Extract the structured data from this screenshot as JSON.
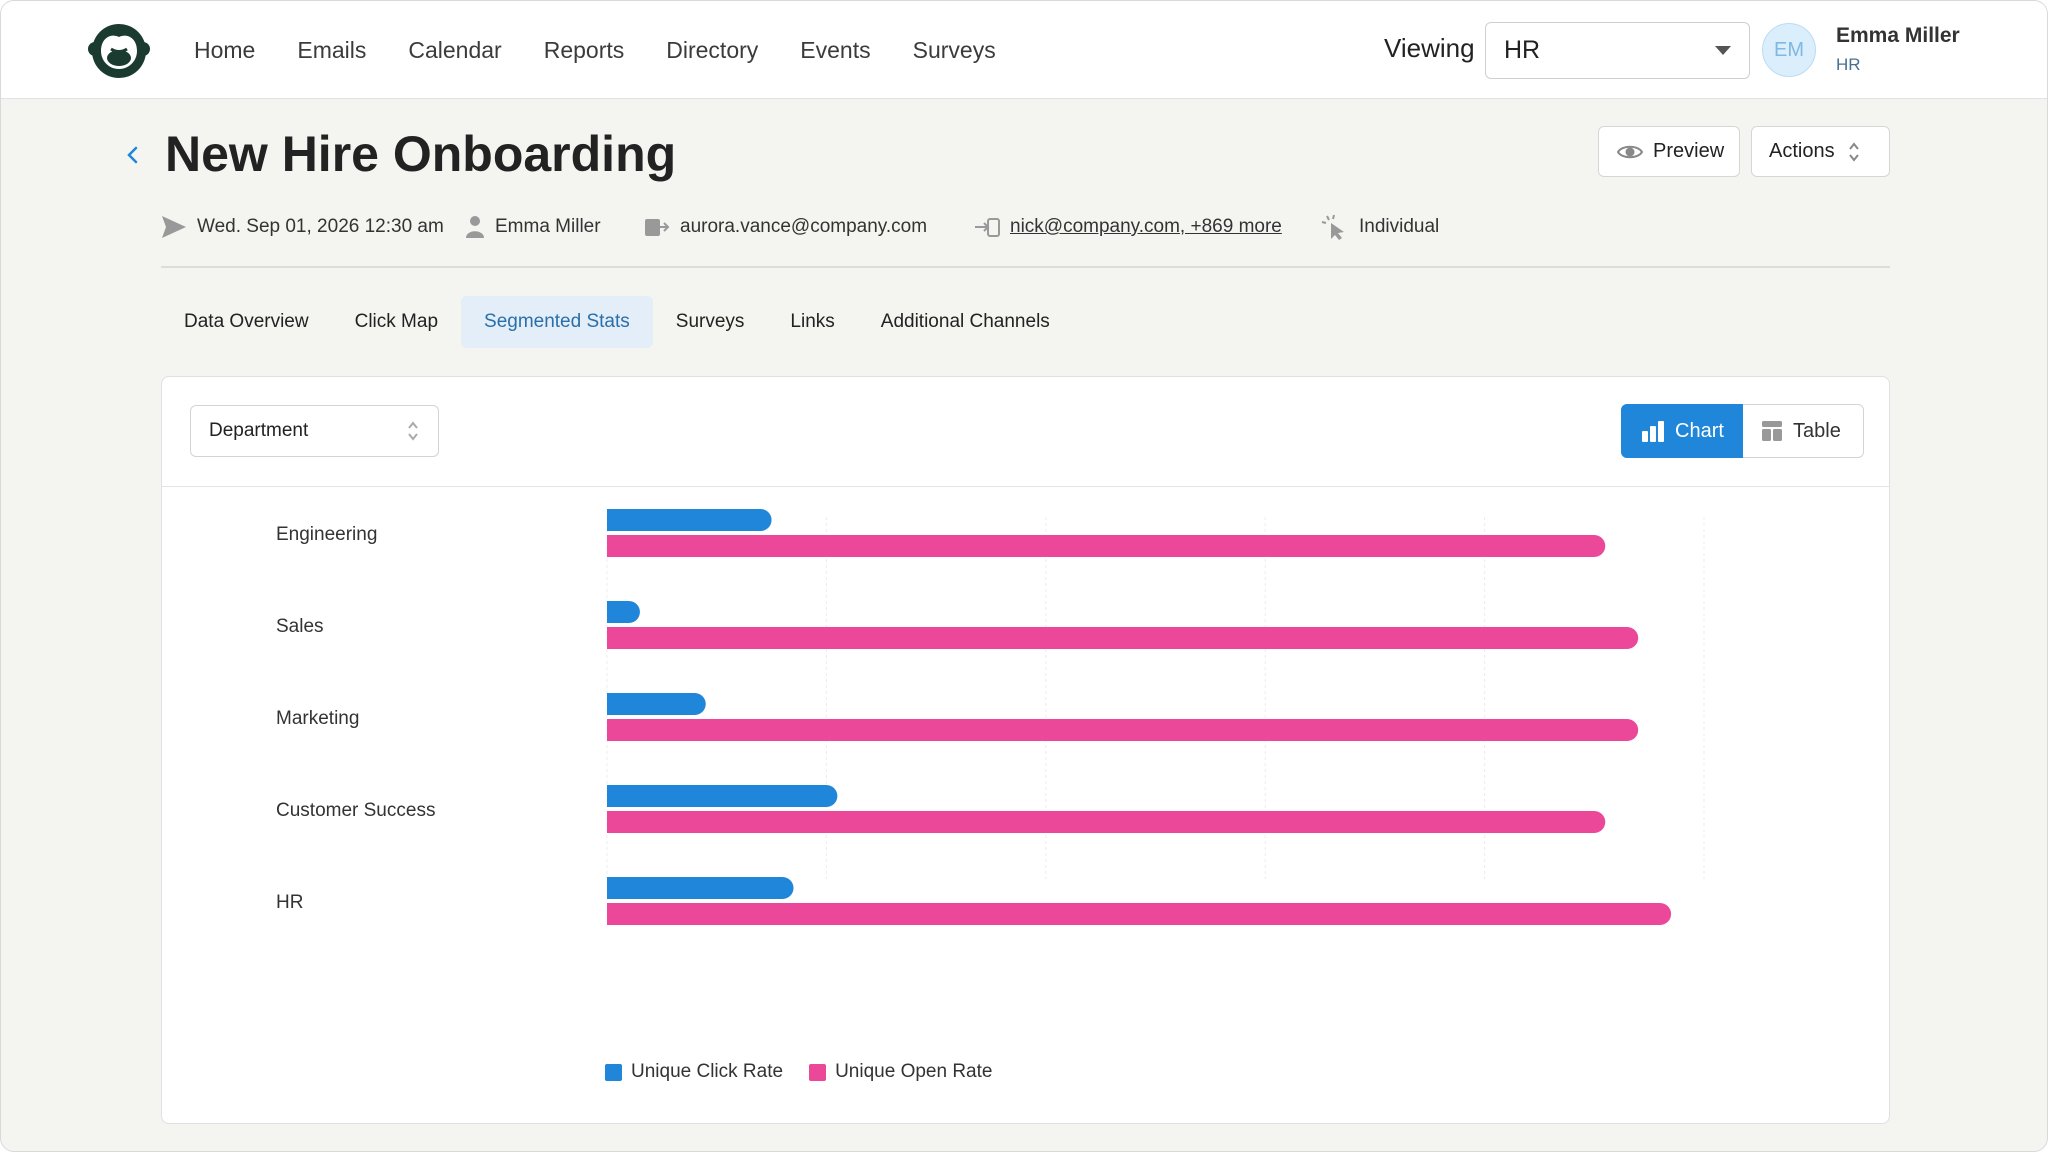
{
  "nav": {
    "items": [
      "Home",
      "Emails",
      "Calendar",
      "Reports",
      "Directory",
      "Events",
      "Surveys"
    ],
    "viewing_label": "Viewing",
    "viewing_value": "HR",
    "user": {
      "initials": "EM",
      "name": "Emma Miller",
      "department": "HR"
    }
  },
  "header": {
    "title": "New Hire Onboarding",
    "preview_label": "Preview",
    "actions_label": "Actions",
    "meta": {
      "sent": "Wed. Sep 01, 2026 12:30 am",
      "author": "Emma Miller",
      "from": "aurora.vance@company.com",
      "recipients": "nick@company.com, +869 more",
      "type": "Individual"
    }
  },
  "tabs": [
    "Data Overview",
    "Click Map",
    "Segmented Stats",
    "Surveys",
    "Links",
    "Additional Channels"
  ],
  "active_tab": "Segmented Stats",
  "panel": {
    "segment_select": "Department",
    "view_toggle": {
      "chart_label": "Chart",
      "table_label": "Table",
      "active": "Chart"
    }
  },
  "colors": {
    "accent": "#1f86d9",
    "click": "#1f86d9",
    "open": "#ec4899"
  },
  "chart_data": {
    "type": "bar",
    "orientation": "horizontal",
    "categories": [
      "Engineering",
      "Sales",
      "Marketing",
      "Customer Success",
      "HR"
    ],
    "series": [
      {
        "name": "Unique Click Rate",
        "color": "#1f86d9",
        "values": [
          15,
          3,
          9,
          21,
          17
        ]
      },
      {
        "name": "Unique Open Rate",
        "color": "#ec4899",
        "values": [
          91,
          94,
          94,
          91,
          97
        ]
      }
    ],
    "xlim": [
      0,
      100
    ],
    "grid": true,
    "legend": "bottom-left"
  }
}
